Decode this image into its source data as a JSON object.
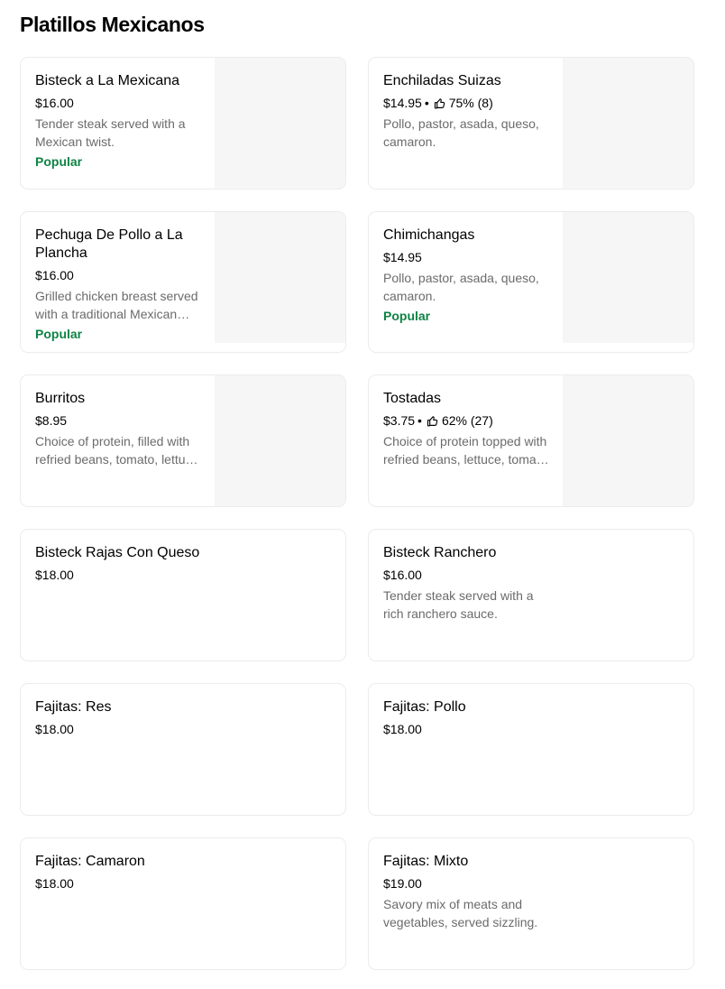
{
  "section": {
    "title": "Platillos Mexicanos"
  },
  "items": [
    {
      "name": "Bisteck a La Mexicana",
      "price": "$16.00",
      "description": "Tender steak served with a Mexican twist.",
      "badge": "Popular",
      "thumb": true
    },
    {
      "name": "Enchiladas Suizas",
      "price": "$14.95",
      "rating": "75% (8)",
      "description": "Pollo, pastor, asada, queso, camaron.",
      "thumb": true
    },
    {
      "name": "Pechuga De Pollo a La Plancha",
      "price": "$16.00",
      "description": "Grilled chicken breast served with a traditional Mexican flavor.",
      "badge": "Popular",
      "thumb": true
    },
    {
      "name": "Chimichangas",
      "price": "$14.95",
      "description": "Pollo, pastor, asada, queso, camaron.",
      "badge": "Popular",
      "thumb": true
    },
    {
      "name": "Burritos",
      "price": "$8.95",
      "description": "Choice of protein, filled with refried beans, tomato, lettuce and cheese.",
      "thumb": true
    },
    {
      "name": "Tostadas",
      "price": "$3.75",
      "rating": "62% (27)",
      "description": "Choice of protein topped with refried beans, lettuce, tomato and cheese.",
      "thumb": true
    },
    {
      "name": "Bisteck Rajas Con Queso",
      "price": "$18.00"
    },
    {
      "name": "Bisteck Ranchero",
      "price": "$16.00",
      "description": "Tender steak served with a rich ranchero sauce."
    },
    {
      "name": "Fajitas: Res",
      "price": "$18.00"
    },
    {
      "name": "Fajitas: Pollo",
      "price": "$18.00"
    },
    {
      "name": "Fajitas: Camaron",
      "price": "$18.00"
    },
    {
      "name": "Fajitas: Mixto",
      "price": "$19.00",
      "description": "Savory mix of meats and vegetables, served sizzling."
    }
  ],
  "icons": {
    "rating": "thumbs-up-icon"
  },
  "colors": {
    "popular": "#0e8345",
    "muted_text": "#6b6b6b",
    "card_border": "#ececec",
    "thumb_placeholder": "#f6f6f6"
  }
}
